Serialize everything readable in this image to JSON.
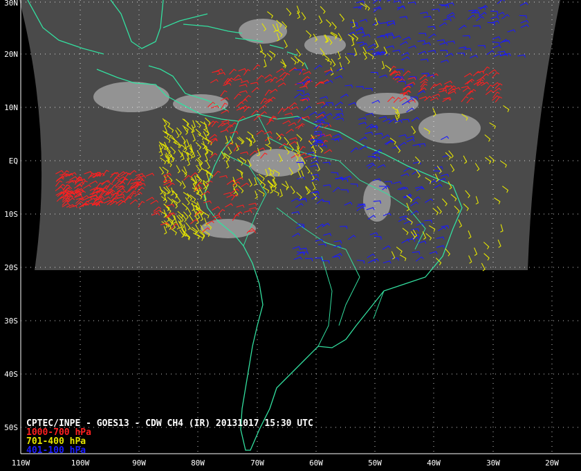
{
  "map": {
    "lat_labels": [
      "30N",
      "20N",
      "10N",
      "EQ",
      "10S",
      "20S",
      "30S",
      "40S",
      "50S"
    ],
    "lon_labels": [
      "110W",
      "100W",
      "90W",
      "80W",
      "70W",
      "60W",
      "50W",
      "40W",
      "30W",
      "20W"
    ],
    "colors": {
      "background": "#000000",
      "coast": "#33e0a0",
      "grid": "#ffffff",
      "low": "#ff2020",
      "mid": "#e6e600",
      "high": "#1a1aff"
    }
  },
  "caption": {
    "title": "CPTEC/INPE - GOES13 - CDW CH4 (IR) 20131017 15:30 UTC",
    "legend": [
      {
        "text": "1000-700 hPa",
        "color": "#ff2020"
      },
      {
        "text": "701-400 hPa",
        "color": "#e6e600"
      },
      {
        "text": "401-100 hPa",
        "color": "#1a1aff"
      }
    ]
  }
}
